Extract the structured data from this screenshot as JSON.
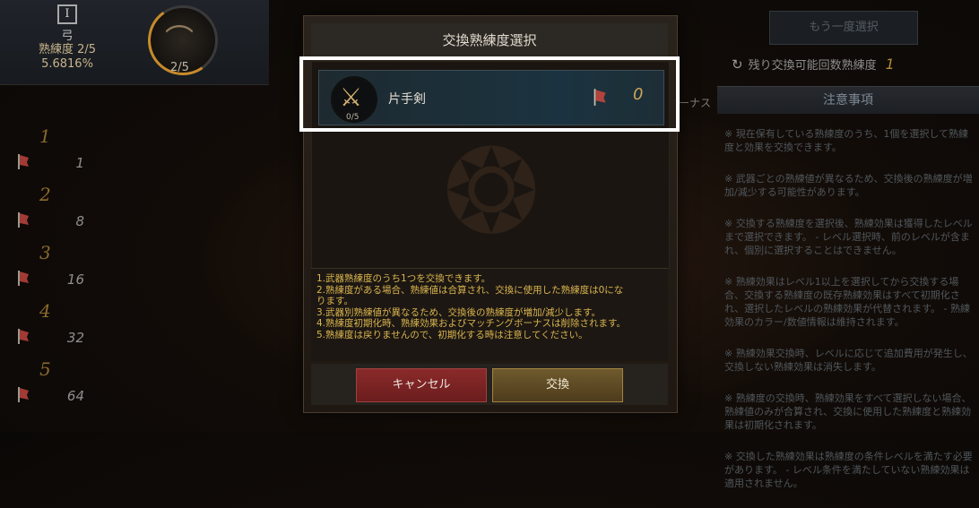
{
  "weapon": {
    "type_icon": "I",
    "name": "弓",
    "mastery_level": "熟練度 2/5",
    "mastery_percent": "5.6816%",
    "ring_count": "2/5"
  },
  "levels": [
    {
      "num": "1",
      "cost": "1"
    },
    {
      "num": "2",
      "cost": "8"
    },
    {
      "num": "3",
      "cost": "16"
    },
    {
      "num": "4",
      "cost": "32"
    },
    {
      "num": "5",
      "cost": "64"
    }
  ],
  "right_panel": {
    "again_button": "もう一度選択",
    "remaining_label": "残り交換可能回数熟練度",
    "remaining_count": "1",
    "notes_header": "注意事項",
    "bonus_partial": "ーナス",
    "notes": [
      "※ 現在保有している熟練度のうち、1個を選択して熟練度と効果を交換できます。",
      "※ 武器ごとの熟練値が異なるため、交換後の熟練度が増加/減少する可能性があります。",
      "※ 交換する熟練度を選択後、熟練効果は獲得したレベルまで選択できます。 - レベル選択時、前のレベルが含まれ、個別に選択することはできません。",
      "※ 熟練効果はレベル1以上を選択してから交換する場合、交換する熟練度の既存熟練効果はすべて初期化され、選択したレベルの熟練効果が代替されます。 - 熟練効果のカラー/数値情報は維持されます。",
      "※ 熟練効果交換時、レベルに応じて追加費用が発生し、交換しない熟練効果は消失します。",
      "※ 熟練度の交換時、熟練効果をすべて選択しない場合、熟練値のみが合算され、交換に使用した熟練度と熟練効果は初期化されます。",
      "※ 交換した熟練効果は熟練度の条件レベルを満たす必要があります。 - レベル条件を満たしていない熟練効果は適用されません。"
    ]
  },
  "modal": {
    "title": "交換熟練度選択",
    "option": {
      "name": "片手剣",
      "count": "0/5",
      "cost": "0"
    },
    "notes": [
      "1.武器熟練度のうち1つを交換できます。",
      "2.熟練度がある場合、熟練値は合算され、交換に使用した熟練度は0にな",
      "ります。",
      "3.武器別熟練値が異なるため、交換後の熟練度が増加/減少します。",
      "4.熟練度初期化時、熟練効果およびマッチングボーナスは削除されます。",
      "5.熟練度は戻りませんので、初期化する時は注意してください。"
    ],
    "cancel_label": "キャンセル",
    "exchange_label": "交換"
  },
  "icons": {
    "cost_icon": "red-flag-icon",
    "sword": "sword-icon",
    "bow": "bow-icon",
    "refresh": "refresh-icon"
  },
  "colors": {
    "highlight": "#ffffff",
    "cancel": "#7a2323",
    "exchange": "#5e4a24",
    "mastery_text": "#c8b48a"
  }
}
